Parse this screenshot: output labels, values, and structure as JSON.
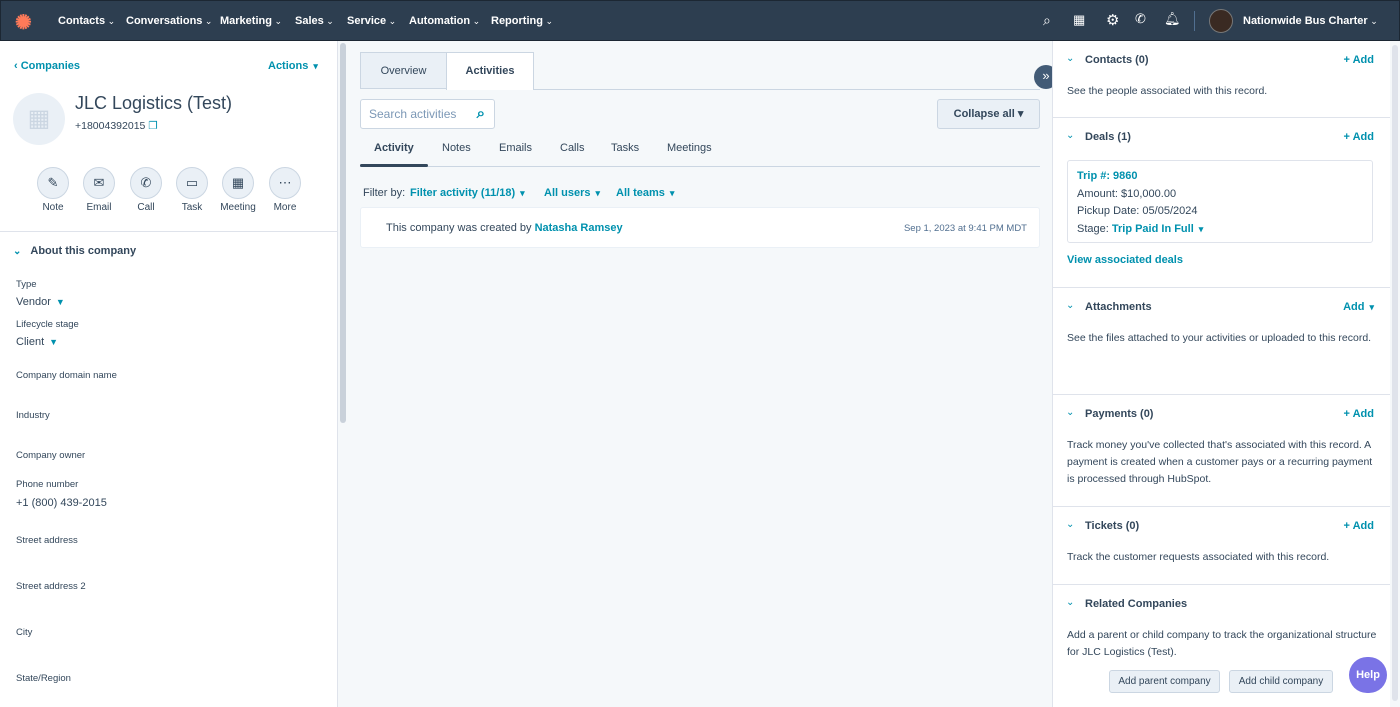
{
  "nav": {
    "items": [
      "Contacts",
      "Conversations",
      "Marketing",
      "Sales",
      "Service",
      "Automation",
      "Reporting"
    ],
    "account": "Nationwide Bus Charter"
  },
  "left": {
    "back": "Companies",
    "actions": "Actions",
    "company_name": "JLC Logistics (Test)",
    "phone": "+18004392015",
    "quick_actions": [
      "Note",
      "Email",
      "Call",
      "Task",
      "Meeting",
      "More"
    ],
    "about_title": "About this company",
    "fields": {
      "type_label": "Type",
      "type_value": "Vendor",
      "lifecycle_label": "Lifecycle stage",
      "lifecycle_value": "Client",
      "domain_label": "Company domain name",
      "industry_label": "Industry",
      "owner_label": "Company owner",
      "phone_label": "Phone number",
      "phone_value": "+1 (800) 439-2015",
      "street_label": "Street address",
      "street2_label": "Street address 2",
      "city_label": "City",
      "state_label": "State/Region"
    }
  },
  "middle": {
    "tabs": [
      "Overview",
      "Activities"
    ],
    "search_placeholder": "Search activities",
    "collapse": "Collapse all",
    "subtabs": [
      "Activity",
      "Notes",
      "Emails",
      "Calls",
      "Tasks",
      "Meetings"
    ],
    "filter_by": "Filter by:",
    "filter_activity": "Filter activity (11/18)",
    "all_users": "All users",
    "all_teams": "All teams",
    "activity": {
      "text": "This company was created by",
      "user": "Natasha Ramsey",
      "time": "Sep 1, 2023 at 9:41 PM MDT"
    }
  },
  "right": {
    "add": "+ Add",
    "contacts": {
      "title": "Contacts (0)",
      "text": "See the people associated with this record."
    },
    "deals": {
      "title": "Deals (1)",
      "deal_name": "Trip #: 9860",
      "amount": "Amount: $10,000.00",
      "pickup": "Pickup Date:  05/05/2024",
      "stage_label": "Stage:",
      "stage": "Trip Paid In Full",
      "view": "View associated deals"
    },
    "attachments": {
      "title": "Attachments",
      "add": "Add",
      "text": "See the files attached to your activities or uploaded to this record."
    },
    "payments": {
      "title": "Payments (0)",
      "text": "Track money you've collected that's associated with this record. A payment is created when a customer pays or a recurring payment is processed through HubSpot."
    },
    "tickets": {
      "title": "Tickets (0)",
      "text": "Track the customer requests associated with this record."
    },
    "related": {
      "title": "Related Companies",
      "text": "Add a parent or child company to track the organizational structure for JLC Logistics (Test).",
      "parent": "Add parent company",
      "child": "Add child company"
    }
  },
  "help": "Help"
}
